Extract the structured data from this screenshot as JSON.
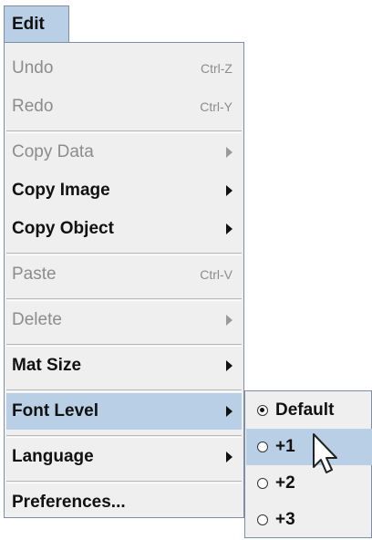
{
  "menubar": {
    "edit_label": "Edit"
  },
  "menu": {
    "items": [
      {
        "label": "Undo",
        "shortcut": "Ctrl-Z",
        "enabled": false
      },
      {
        "label": "Redo",
        "shortcut": "Ctrl-Y",
        "enabled": false
      },
      {
        "label": "Copy Data",
        "submenu": true,
        "enabled": false
      },
      {
        "label": "Copy Image",
        "submenu": true,
        "enabled": true
      },
      {
        "label": "Copy Object",
        "submenu": true,
        "enabled": true
      },
      {
        "label": "Paste",
        "shortcut": "Ctrl-V",
        "enabled": false
      },
      {
        "label": "Delete",
        "submenu": true,
        "enabled": false
      },
      {
        "label": "Mat Size",
        "submenu": true,
        "enabled": true
      },
      {
        "label": "Font Level",
        "submenu": true,
        "enabled": true,
        "highlighted": true
      },
      {
        "label": "Language",
        "submenu": true,
        "enabled": true
      },
      {
        "label": "Preferences...",
        "enabled": true
      }
    ]
  },
  "font_level_submenu": {
    "items": [
      {
        "label": "Default",
        "selected": true
      },
      {
        "label": "+1",
        "selected": false,
        "highlighted": true
      },
      {
        "label": "+2",
        "selected": false
      },
      {
        "label": "+3",
        "selected": false
      }
    ]
  },
  "icons": {
    "submenu_arrow": "triangle-right-icon",
    "radio": "radio-button-icon",
    "cursor": "mouse-pointer-icon"
  },
  "colors": {
    "highlight": "#b8cfe5",
    "menu_bg": "#efefef",
    "border": "#7f8fa3",
    "disabled_text": "#8c8c8c",
    "text": "#111111"
  }
}
